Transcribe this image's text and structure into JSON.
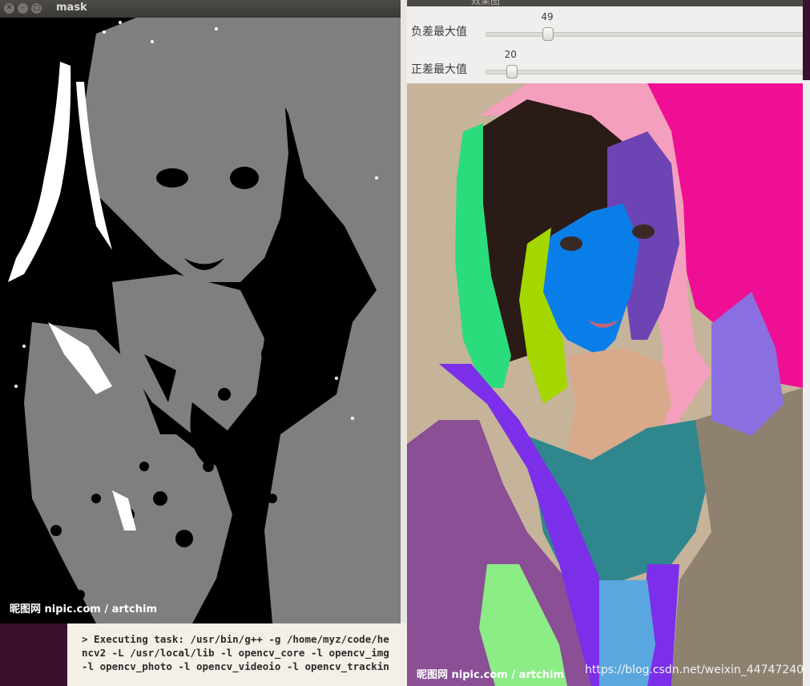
{
  "mask_window": {
    "title": "mask",
    "watermark": "昵图网 nipic.com / artchim",
    "icons": [
      "close-icon",
      "minimize-icon",
      "maximize-icon"
    ]
  },
  "result_window": {
    "title": "效果图",
    "sliders": [
      {
        "label": "负差最大值",
        "value": "49",
        "fraction": 0.196
      },
      {
        "label": "正差最大值",
        "value": "20",
        "fraction": 0.08
      }
    ],
    "watermark": "昵图网 nipic.com / artchim",
    "credit": "https://blog.csdn.net/weixin_44747240"
  },
  "terminal": {
    "lines": [
      "> Executing task: /usr/bin/g++ -g /home/myz/code/he",
      "ncv2 -L /usr/local/lib -l opencv_core -l opencv_img",
      "-l opencv_photo -l opencv_videoio -l opencv_trackin"
    ]
  },
  "colors": {
    "mask_gray": "#7f7f7f",
    "mask_white": "#ffffff",
    "pink": "#f59fbe",
    "magenta": "#ef0f94",
    "blue": "#0a7ee8",
    "green": "#2bdc7c",
    "purple": "#8446c9",
    "teal": "#2f878d",
    "mauve": "#8a4f95"
  }
}
